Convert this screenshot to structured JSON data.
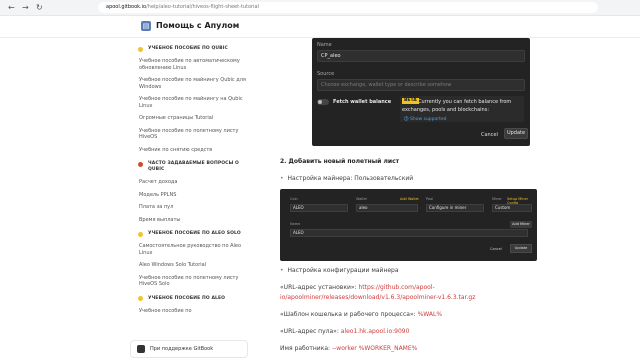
{
  "browser": {
    "url_host": "apool.gitbook.io",
    "url_path": "/help/aleo-tutorial/hiveos-flight-sheet-tutorial",
    "nav_back": "←",
    "nav_forward": "→",
    "nav_reload": "↻"
  },
  "header": {
    "title": "Помощь с Апулом"
  },
  "sidebar": {
    "sections": [
      {
        "title": "УЧЕБНОЕ ПОСОБИЕ ПО QUBIC",
        "dot_color": "#f2c230",
        "items": [
          "Учебное пособие по автоматическому обновлению Linux",
          "Учебное пособие по майнингу Qubic для Windows",
          "Учебное пособие по майнингу на Qubic Linux",
          "Огромные страницы Tutorial",
          "Учебное пособие по полетному листу HiveOS",
          "Учебник по снятию средств"
        ]
      },
      {
        "title": "ЧАСТО ЗАДАВАЕМЫЕ ВОПРОСЫ О QUBIC",
        "dot_color": "#d04b2d",
        "items": [
          "Расчет дохода",
          "Модель PPLNS",
          "Плата за пул",
          "Время выплаты"
        ]
      },
      {
        "title": "УЧЕБНОЕ ПОСОБИЕ ПО ALEO SOLO",
        "dot_color": "#f2c230",
        "items": [
          "Самостоятельное руководство по Aleo Linux",
          "Aleo Windows Solo Tutorial",
          "Учебное пособие по полетному листу HiveOS Solo"
        ]
      },
      {
        "title": "УЧЕБНОЕ ПОСОБИЕ ПО ALEO",
        "dot_color": "#f2c230",
        "items": [
          "Учебное пособие по"
        ]
      }
    ],
    "footer": "При поддержке GitBook"
  },
  "wallet_form": {
    "name_label": "Name",
    "name_value": "CP_aleo",
    "source_label": "Source",
    "source_placeholder": "Choose exchange, wallet type or describe somehow",
    "fetch_label": "Fetch wallet balance",
    "beta_badge": "BETA",
    "beta_text": "Currently you can fetch balance from exchanges, pools and blockchains:",
    "beta_link": "Show supported",
    "cancel": "Cancel",
    "update": "Update"
  },
  "content": {
    "step2_heading": "2. Добавить новый полетный лист",
    "bullet1": "Настройка майнера: Пользовательский",
    "bullet2": "Настройка конфигурации майнера",
    "url_label": "«URL-адрес установки»:",
    "url_value": "https://github.com/apool-io/apoolminer/releases/download/v1.6.3/apoolminer-v1.6.3.tar.gz",
    "template_label": "«Шаблон кошелька и рабочего процесса»:",
    "template_value": "%WAL%",
    "pool_label": "«URL-адрес пула»:",
    "pool_value": "aleo1.hk.apool.io:9090",
    "worker_label": "Имя работника:",
    "worker_value": "--worker %WORKER_NAME%"
  },
  "miner_config": {
    "coin_label": "Coin",
    "coin_value": "ALEO",
    "wallet_label": "Wallet",
    "wallet_value": "aleo",
    "add_wallet": "Add Wallet",
    "pool_label": "Pool",
    "pool_value": "Configure in miner",
    "miner_label": "Miner",
    "miner_value": "Custom",
    "setup_config": "Setup Miner Config",
    "name_label": "Name",
    "name_value": "ALEO",
    "add_miner": "Add Miner",
    "cancel": "Cancel",
    "update": "Update"
  }
}
